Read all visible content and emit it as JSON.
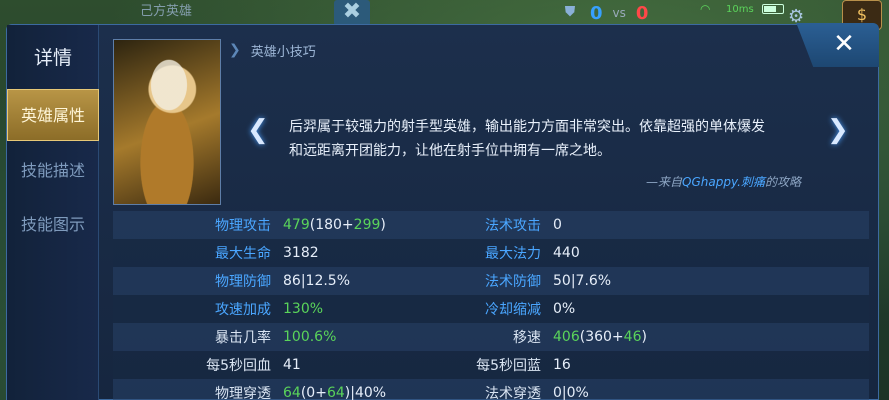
{
  "top": {
    "team_label": "己方英雄",
    "score_left": "0",
    "score_vs": "vs",
    "score_right": "0",
    "ping": "10ms"
  },
  "sidebar": {
    "title": "详情",
    "tabs": [
      {
        "label": "英雄属性",
        "active": true
      },
      {
        "label": "技能描述",
        "active": false
      },
      {
        "label": "技能图示",
        "active": false
      }
    ]
  },
  "tips": {
    "title": "英雄小技巧",
    "text": "后羿属于较强力的射手型英雄，输出能力方面非常突出。依靠超强的单体爆发和远距离开团能力，让他在射手位中拥有一席之地。",
    "credit_prefix": "—来自",
    "credit_author": "QGhappy.刺痛",
    "credit_suffix": "的攻略"
  },
  "stats": {
    "rows": [
      {
        "l1": "物理攻击",
        "v1a": "479",
        "v1b": "(180+",
        "v1c": "299",
        "v1d": ")",
        "l2": "法术攻击",
        "v2a": "0",
        "v2b": "",
        "v2c": "",
        "v2d": ""
      },
      {
        "l1": "最大生命",
        "v1a": "3182",
        "v1b": "",
        "v1c": "",
        "v1d": "",
        "l2": "最大法力",
        "v2a": "440",
        "v2b": "",
        "v2c": "",
        "v2d": ""
      },
      {
        "l1": "物理防御",
        "v1a": "86|12.5%",
        "v1b": "",
        "v1c": "",
        "v1d": "",
        "l2": "法术防御",
        "v2a": "50|7.6%",
        "v2b": "",
        "v2c": "",
        "v2d": ""
      },
      {
        "l1": "攻速加成",
        "v1a": "130%",
        "v1b": "",
        "v1c": "",
        "v1d": "",
        "l2": "冷却缩减",
        "v2a": "0%",
        "v2b": "",
        "v2c": "",
        "v2d": ""
      },
      {
        "l1": "暴击几率",
        "v1a": "100.6%",
        "v1b": "",
        "v1c": "",
        "v1d": "",
        "l2": "移速",
        "v2a": "406",
        "v2b": "(360+",
        "v2c": "46",
        "v2d": ")"
      },
      {
        "l1": "每5秒回血",
        "v1a": "41",
        "v1b": "",
        "v1c": "",
        "v1d": "",
        "l2": "每5秒回蓝",
        "v2a": "16",
        "v2b": "",
        "v2c": "",
        "v2d": ""
      },
      {
        "l1": "物理穿透",
        "v1a": "64",
        "v1b": "(0+",
        "v1c": "64",
        "v1d": ")|40%",
        "l2": "法术穿透",
        "v2a": "0|0%",
        "v2b": "",
        "v2c": "",
        "v2d": ""
      }
    ]
  },
  "colors": {
    "accent_blue": "#4aa6ff",
    "bonus_green": "#5ad45a",
    "active_tab_gold": "#b89546"
  },
  "icons": [
    "close-icon",
    "chevron-left-icon",
    "chevron-right-icon",
    "gear-icon",
    "wifi-icon",
    "battery-icon",
    "bag-icon"
  ]
}
